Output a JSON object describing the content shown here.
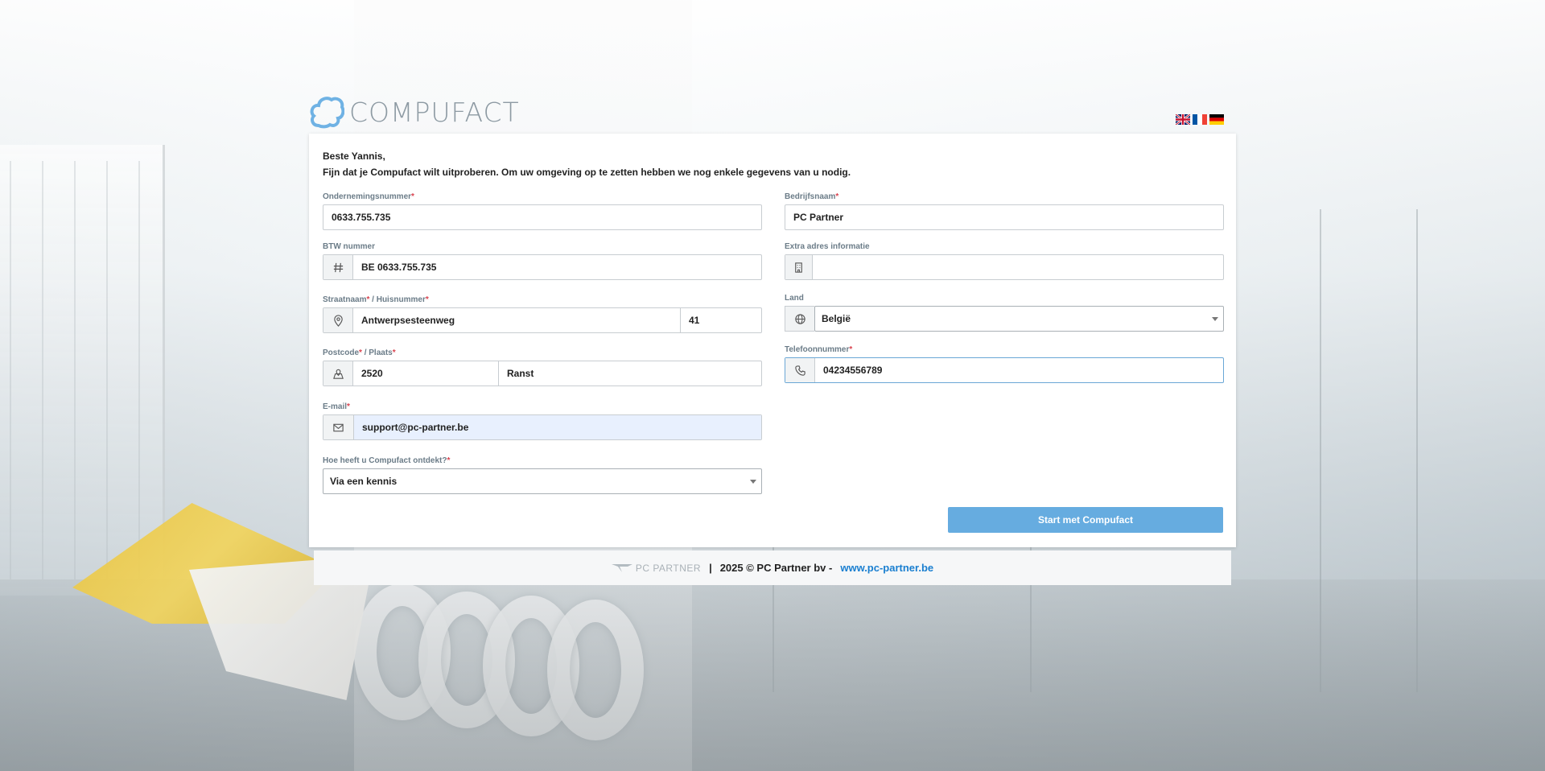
{
  "brand": {
    "name": "COMPUFACT",
    "accent": "#66ace0"
  },
  "languages": [
    {
      "name": "English",
      "icon": "flag-uk-icon"
    },
    {
      "name": "Français",
      "icon": "flag-fr-icon"
    },
    {
      "name": "Deutsch",
      "icon": "flag-de-icon"
    }
  ],
  "intro": {
    "greeting": "Beste Yannis,",
    "message": "Fijn dat je Compufact wilt uitproberen. Om uw omgeving op te zetten hebben we nog enkele gegevens van u nodig."
  },
  "form": {
    "company_number": {
      "label": "Ondernemingsnummer",
      "value": "0633.755.735"
    },
    "company_name": {
      "label": "Bedrijfsnaam",
      "value": "PC Partner"
    },
    "vat": {
      "label": "BTW nummer",
      "value": "BE 0633.755.735",
      "icon": "hash-icon"
    },
    "extra_address": {
      "label": "Extra adres informatie",
      "value": "",
      "icon": "building-icon"
    },
    "street": {
      "label": "Straatnaam",
      "label2": "Huisnummer",
      "value": "Antwerpsesteenweg",
      "number": "41",
      "icon": "map-pin-icon"
    },
    "country": {
      "label": "Land",
      "value": "België",
      "icon": "globe-icon"
    },
    "postcode": {
      "label": "Postcode",
      "label2": "Plaats",
      "value": "2520",
      "city": "Ranst",
      "icon": "map-icon"
    },
    "phone": {
      "label": "Telefoonnummer",
      "value": "04234556789",
      "icon": "phone-icon"
    },
    "email": {
      "label": "E-mail",
      "value": "support@pc-partner.be",
      "icon": "envelope-icon"
    },
    "discovery": {
      "label": "Hoe heeft u Compufact ontdekt?",
      "value": "Via een kennis"
    },
    "required_mark": "*",
    "slash": " / ",
    "submit_label": "Start met Compufact"
  },
  "footer": {
    "logo_text": "PC PARTNER",
    "separator": "|",
    "copyright": "2025 © PC Partner bv -",
    "link": "www.pc-partner.be",
    "link_color": "#1a7fd0"
  }
}
